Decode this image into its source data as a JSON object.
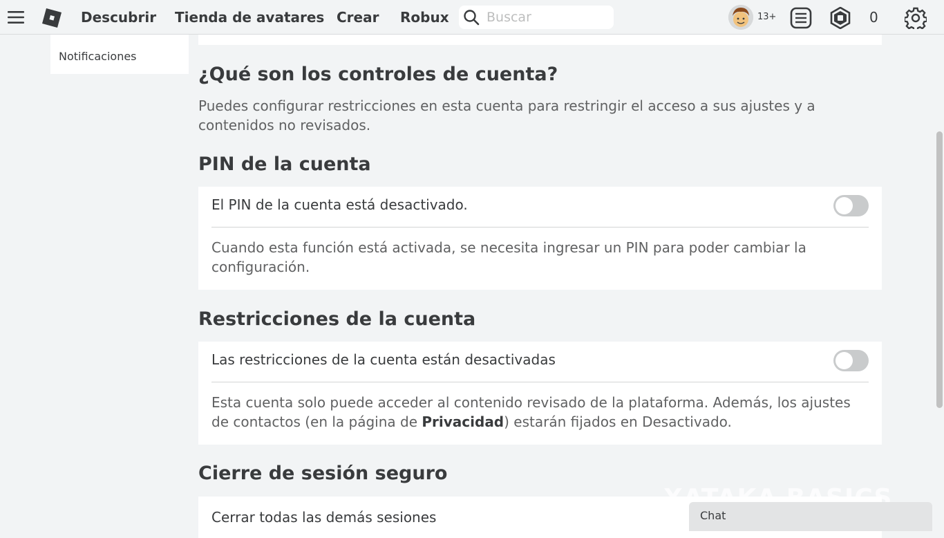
{
  "nav": {
    "discover": "Descubrir",
    "avatar_shop": "Tienda de avatares",
    "create": "Crear",
    "robux": "Robux",
    "search_placeholder": "Buscar",
    "age_badge": "13+",
    "robux_balance": "0"
  },
  "icons": {
    "menu": "hamburger-menu-icon",
    "logo": "roblox-logo-icon",
    "search": "search-icon",
    "chat_list": "messages-icon",
    "robux": "robux-icon",
    "settings": "gear-icon"
  },
  "sidebar": {
    "items": [
      {
        "label": "Notificaciones"
      }
    ]
  },
  "main": {
    "intro": {
      "title": "¿Qué son los controles de cuenta?",
      "description": "Puedes configurar restricciones en esta cuenta para restringir el acceso a sus ajustes y a contenidos no revisados."
    },
    "pin": {
      "title": "PIN de la cuenta",
      "status": "El PIN de la cuenta está desactivado.",
      "enabled": false,
      "description": "Cuando esta función está activada, se necesita ingresar un PIN para poder cambiar la configuración."
    },
    "restrictions": {
      "title": "Restricciones de la cuenta",
      "status": "Las restricciones de la cuenta están desactivadas",
      "enabled": false,
      "description_before": "Esta cuenta solo puede acceder al contenido revisado de la plataforma. Además, los ajustes de contactos (en la página de ",
      "description_link": "Privacidad",
      "description_after": ") estarán fijados en Desactivado."
    },
    "secure_logout": {
      "title": "Cierre de sesión seguro",
      "action": "Cerrar todas las demás sesiones"
    }
  },
  "chat": {
    "label": "Chat"
  },
  "watermark": "XATAKA BASICS",
  "colors": {
    "background": "#f2f4f5",
    "card": "#ffffff",
    "text_primary": "#393b3d",
    "text_secondary": "#606162",
    "toggle_off": "#c9cbcc"
  }
}
